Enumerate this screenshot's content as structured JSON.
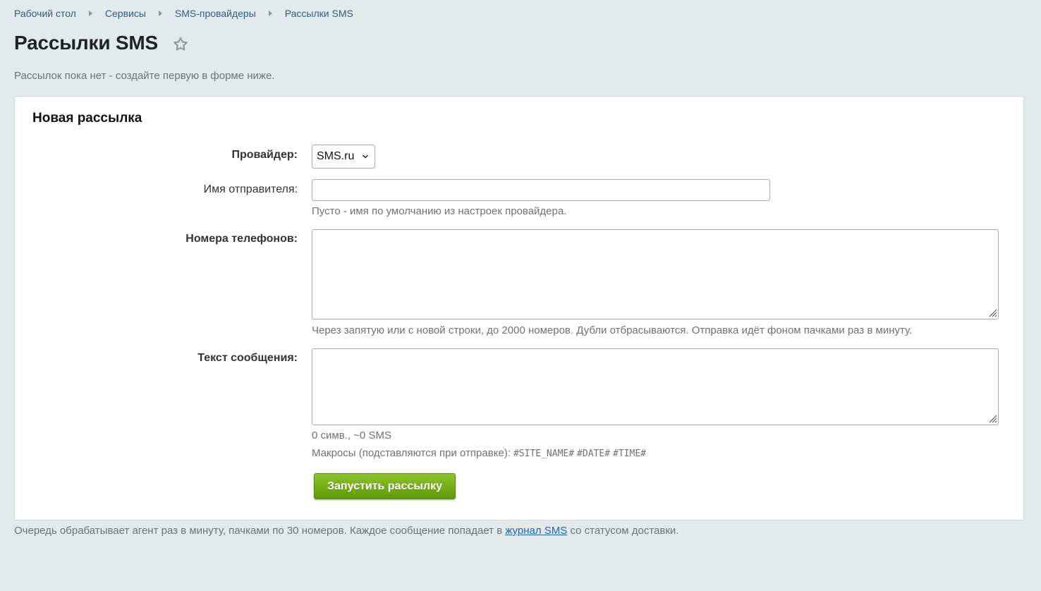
{
  "breadcrumbs": [
    {
      "label": "Рабочий стол"
    },
    {
      "label": "Сервисы"
    },
    {
      "label": "SMS-провайдеры"
    },
    {
      "label": "Рассылки SMS"
    }
  ],
  "page": {
    "title": "Рассылки SMS",
    "notice": "Рассылок пока нет - создайте первую в форме ниже."
  },
  "form": {
    "title": "Новая рассылка",
    "provider": {
      "label": "Провайдер:",
      "selected": "SMS.ru"
    },
    "sender": {
      "label": "Имя отправителя:",
      "value": "",
      "placeholder": "",
      "hint": "Пусто - имя по умолчанию из настроек провайдера."
    },
    "phones": {
      "label": "Номера телефонов:",
      "value": "",
      "hint": "Через запятую или с новой строки, до 2000 номеров. Дубли отбрасываются. Отправка идёт фоном пачками раз в минуту."
    },
    "message": {
      "label": "Текст сообщения:",
      "value": "",
      "counter": "0 симв., ~0 SMS",
      "macros_label": "Макросы (подставляются при отправке):",
      "macros": [
        "#SITE_NAME#",
        "#DATE#",
        "#TIME#"
      ]
    },
    "submit_label": "Запустить рассылку"
  },
  "footer": {
    "text_before": "Очередь обрабатывает агент раз в минуту, пачками по 30 номеров. Каждое сообщение попадает в ",
    "link": "журнал SMS",
    "text_after": " со статусом доставки."
  },
  "colors": {
    "background": "#e3eaec",
    "link": "#2e5c8a",
    "submit": "#6fa812"
  },
  "icons": {
    "favorite": "star-icon",
    "select": "chevron-down-icon",
    "textarea_resize": "resize-grip-icon"
  }
}
